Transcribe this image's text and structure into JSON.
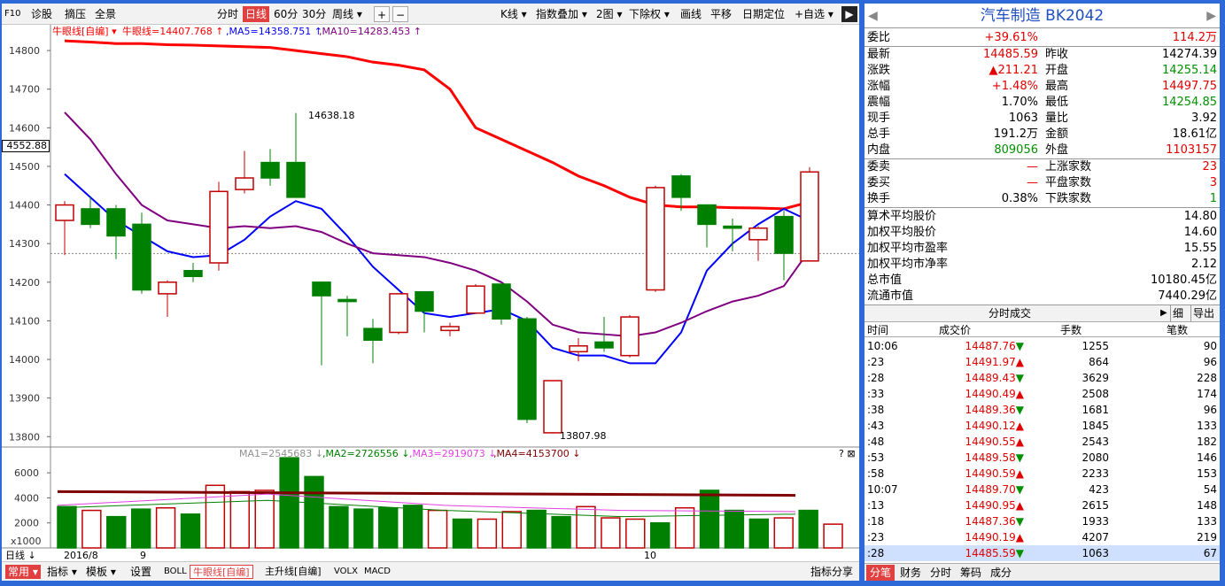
{
  "toolbar": {
    "f10": "F10",
    "zhenggu": "诊股",
    "zeya": "摘压",
    "quanjing": "全景",
    "fenshi": "分时",
    "rixian": "日线",
    "min60": "60分",
    "min30": "30分",
    "zhouxian": "周线 ▾",
    "plus": "+",
    "minus": "−",
    "kxian": "K线 ▾",
    "zhishu": "指数叠加 ▾",
    "tu2": "2图 ▾",
    "xiachuquan": "下除权 ▾",
    "huaxian": "画线",
    "pingyi": "平移",
    "riqidingwei": "日期定位",
    "zixuan": "+自选 ▾",
    "next": "▶"
  },
  "legend": {
    "niuyan": "牛眼线[自编] ▾",
    "niuyan_val": "牛眼线=14407.768 ↑",
    "ma5": ",MA5=14358.751 ↑",
    "ma10": ",MA10=14283.453 ↑"
  },
  "y_axis": {
    "ticks": [
      "14800",
      "14700",
      "14600",
      "14500",
      "14400",
      "14300",
      "14200",
      "14100",
      "14000",
      "13900",
      "13800"
    ],
    "current": "4552.88"
  },
  "annotations": {
    "high": "14638.18",
    "low": "13807.98"
  },
  "vol_legend": {
    "ma1": "MA1=2545683 ↓",
    "ma2": ",MA2=2726556 ↓",
    "ma3": ",MA3=2919073 ↓",
    "ma4": ",MA4=4153700 ↓",
    "help": "? ⊠"
  },
  "vol_axis": {
    "ticks": [
      "6000",
      "4000",
      "2000"
    ],
    "unit": "x1000"
  },
  "x_axis": {
    "rixian": "日线 ↓",
    "m1": "2016/8",
    "m2": "9",
    "m3": "10"
  },
  "bottombar": {
    "changyong": "常用 ▾",
    "zhibiao": "指标 ▾",
    "moban": "模板 ▾",
    "shezhi": "设置",
    "boll": "BOLL",
    "niuyan": "牛眼线[自编]",
    "zhusheng": "主升线[自编]",
    "volx": "VOLX",
    "macd": "MACD",
    "fenxiang": "指标分享"
  },
  "colors": {
    "up": "#c00000",
    "down": "#008000",
    "ma_red": "#ff0000",
    "ma5": "#0000ff",
    "ma10": "#800080"
  },
  "chart_data": {
    "type": "candlestick",
    "ylim": [
      13780,
      14830
    ],
    "candles": [
      {
        "o": 14360,
        "c": 14400,
        "h": 14410,
        "l": 14270
      },
      {
        "o": 14390,
        "c": 14350,
        "h": 14420,
        "l": 14340
      },
      {
        "o": 14390,
        "c": 14320,
        "h": 14400,
        "l": 14260
      },
      {
        "o": 14350,
        "c": 14180,
        "h": 14380,
        "l": 14170
      },
      {
        "o": 14170,
        "c": 14200,
        "h": 14205,
        "l": 14110
      },
      {
        "o": 14230,
        "c": 14215,
        "h": 14250,
        "l": 14200
      },
      {
        "o": 14250,
        "c": 14435,
        "h": 14460,
        "l": 14230
      },
      {
        "o": 14440,
        "c": 14470,
        "h": 14540,
        "l": 14430
      },
      {
        "o": 14510,
        "c": 14470,
        "h": 14545,
        "l": 14450
      },
      {
        "o": 14510,
        "c": 14420,
        "h": 14638.18,
        "l": 14420
      },
      {
        "o": 14200,
        "c": 14165,
        "h": 14200,
        "l": 13985
      },
      {
        "o": 14155,
        "c": 14150,
        "h": 14165,
        "l": 14060
      },
      {
        "o": 14080,
        "c": 14050,
        "h": 14105,
        "l": 13990
      },
      {
        "o": 14070,
        "c": 14170,
        "h": 14170,
        "l": 14065
      },
      {
        "o": 14175,
        "c": 14125,
        "h": 14175,
        "l": 14070
      },
      {
        "o": 14075,
        "c": 14085,
        "h": 14095,
        "l": 14060
      },
      {
        "o": 14120,
        "c": 14190,
        "h": 14195,
        "l": 14120
      },
      {
        "o": 14195,
        "c": 14105,
        "h": 14195,
        "l": 14090
      },
      {
        "o": 14105,
        "c": 13845,
        "h": 14110,
        "l": 13835
      },
      {
        "o": 13810,
        "c": 13945,
        "h": 13945,
        "l": 13807.98
      },
      {
        "o": 14020,
        "c": 14035,
        "h": 14055,
        "l": 13995
      },
      {
        "o": 14045,
        "c": 14030,
        "h": 14110,
        "l": 14020
      },
      {
        "o": 14010,
        "c": 14110,
        "h": 14115,
        "l": 14005
      },
      {
        "o": 14180,
        "c": 14445,
        "h": 14450,
        "l": 14175
      },
      {
        "o": 14475,
        "c": 14420,
        "h": 14480,
        "l": 14385
      },
      {
        "o": 14400,
        "c": 14350,
        "h": 14400,
        "l": 14290
      },
      {
        "o": 14345,
        "c": 14340,
        "h": 14365,
        "l": 14280
      },
      {
        "o": 14310,
        "c": 14340,
        "h": 14345,
        "l": 14255
      },
      {
        "o": 14370,
        "c": 14275,
        "h": 14385,
        "l": 14205
      },
      {
        "o": 14255,
        "c": 14485.59,
        "h": 14497.75,
        "l": 14254.85
      }
    ],
    "ma_red": [
      14825,
      14822,
      14818,
      14818,
      14815,
      14814,
      14812,
      14810,
      14808,
      14800,
      14792,
      14784,
      14770,
      14762,
      14750,
      14700,
      14600,
      14570,
      14540,
      14510,
      14475,
      14450,
      14420,
      14400,
      14395,
      14395,
      14393,
      14392,
      14390,
      14407.768
    ],
    "ma5": [
      14480,
      14420,
      14360,
      14320,
      14280,
      14265,
      14270,
      14310,
      14370,
      14410,
      14390,
      14320,
      14240,
      14180,
      14120,
      14110,
      14120,
      14130,
      14100,
      14030,
      14010,
      14010,
      13990,
      13990,
      14070,
      14230,
      14300,
      14350,
      14390,
      14358.751
    ],
    "ma10": [
      14640,
      14570,
      14480,
      14400,
      14360,
      14350,
      14340,
      14345,
      14340,
      14345,
      14330,
      14300,
      14275,
      14270,
      14265,
      14250,
      14230,
      14200,
      14150,
      14090,
      14070,
      14065,
      14060,
      14070,
      14095,
      14125,
      14150,
      14165,
      14190,
      14283.453
    ],
    "volume": [
      3.3,
      3.0,
      2.5,
      3.1,
      3.2,
      2.7,
      5.0,
      4.5,
      4.6,
      7.2,
      5.7,
      3.3,
      3.1,
      3.2,
      3.4,
      3.0,
      2.3,
      2.3,
      2.9,
      3.0,
      2.5,
      3.3,
      2.4,
      2.3,
      2.0,
      3.2,
      4.6,
      3.0,
      2.3,
      2.4,
      3.0,
      1.9
    ],
    "vol_ylim": [
      0,
      7000
    ]
  },
  "panel": {
    "title": "汽车制造 BK2042",
    "weibi": {
      "l": "委比",
      "v": "+39.61%",
      "v2": "114.2万"
    },
    "rows": [
      {
        "l1": "最新",
        "v1": "14485.59",
        "l2": "昨收",
        "v2": "14274.39",
        "c1": "red",
        "c2": ""
      },
      {
        "l1": "涨跌",
        "v1": "▲211.21",
        "l2": "开盘",
        "v2": "14255.14",
        "c1": "red",
        "c2": "grn"
      },
      {
        "l1": "涨幅",
        "v1": "+1.48%",
        "l2": "最高",
        "v2": "14497.75",
        "c1": "red",
        "c2": "red"
      },
      {
        "l1": "震幅",
        "v1": "1.70%",
        "l2": "最低",
        "v2": "14254.85",
        "c1": "",
        "c2": "grn"
      },
      {
        "l1": "现手",
        "v1": "1063",
        "l2": "量比",
        "v2": "3.92",
        "c1": "",
        "c2": ""
      },
      {
        "l1": "总手",
        "v1": "191.2万",
        "l2": "金额",
        "v2": "18.61亿",
        "c1": "",
        "c2": ""
      },
      {
        "l1": "内盘",
        "v1": "809056",
        "l2": "外盘",
        "v2": "1103157",
        "c1": "grn",
        "c2": "red"
      }
    ],
    "rows2": [
      {
        "l1": "委卖",
        "v1": "—",
        "l2": "上涨家数",
        "v2": "23",
        "c1": "red",
        "c2": "red"
      },
      {
        "l1": "委买",
        "v1": "—",
        "l2": "平盘家数",
        "v2": "3",
        "c1": "red",
        "c2": "red"
      },
      {
        "l1": "换手",
        "v1": "0.38%",
        "l2": "下跌家数",
        "v2": "1",
        "c1": "",
        "c2": "grn"
      }
    ],
    "rows3": [
      {
        "l": "算术平均股价",
        "v": "14.80"
      },
      {
        "l": "加权平均股价",
        "v": "14.60"
      },
      {
        "l": "加权平均市盈率",
        "v": "15.55"
      },
      {
        "l": "加权平均市净率",
        "v": "2.12"
      },
      {
        "l": "总市值",
        "v": "10180.45亿"
      },
      {
        "l": "流通市值",
        "v": "7440.29亿"
      }
    ],
    "fsc": {
      "title": "分时成交",
      "xi": "细",
      "daochu": "导出",
      "h_time": "时间",
      "h_price": "成交价",
      "h_shou": "手数",
      "h_bi": "笔数"
    },
    "ticks": [
      {
        "t": "10:06",
        "p": "14487.76▼",
        "s": "1255",
        "b": "90",
        "c": "red"
      },
      {
        "t": ":23",
        "p": "14491.97▲",
        "s": "864",
        "b": "96",
        "c": "red"
      },
      {
        "t": ":28",
        "p": "14489.43▼",
        "s": "3629",
        "b": "228",
        "c": "red"
      },
      {
        "t": ":33",
        "p": "14490.49▲",
        "s": "2508",
        "b": "174",
        "c": "red"
      },
      {
        "t": ":38",
        "p": "14489.36▼",
        "s": "1681",
        "b": "96",
        "c": "red"
      },
      {
        "t": ":43",
        "p": "14490.12▲",
        "s": "1845",
        "b": "133",
        "c": "red"
      },
      {
        "t": ":48",
        "p": "14490.55▲",
        "s": "2543",
        "b": "182",
        "c": "red"
      },
      {
        "t": ":53",
        "p": "14489.58▼",
        "s": "2080",
        "b": "146",
        "c": "red"
      },
      {
        "t": ":58",
        "p": "14490.59▲",
        "s": "2233",
        "b": "153",
        "c": "red"
      },
      {
        "t": "10:07",
        "p": "14489.70▼",
        "s": "423",
        "b": "54",
        "c": "red"
      },
      {
        "t": ":13",
        "p": "14490.95▲",
        "s": "2615",
        "b": "148",
        "c": "red"
      },
      {
        "t": ":18",
        "p": "14487.36▼",
        "s": "1933",
        "b": "133",
        "c": "red"
      },
      {
        "t": ":23",
        "p": "14490.19▲",
        "s": "4207",
        "b": "219",
        "c": "red"
      },
      {
        "t": ":28",
        "p": "14485.59▼",
        "s": "1063",
        "b": "67",
        "c": "red"
      }
    ],
    "tabs": {
      "fenbi": "分笔",
      "caiwu": "财务",
      "fenshi": "分时",
      "chouma": "筹码",
      "chengfen": "成分"
    }
  }
}
